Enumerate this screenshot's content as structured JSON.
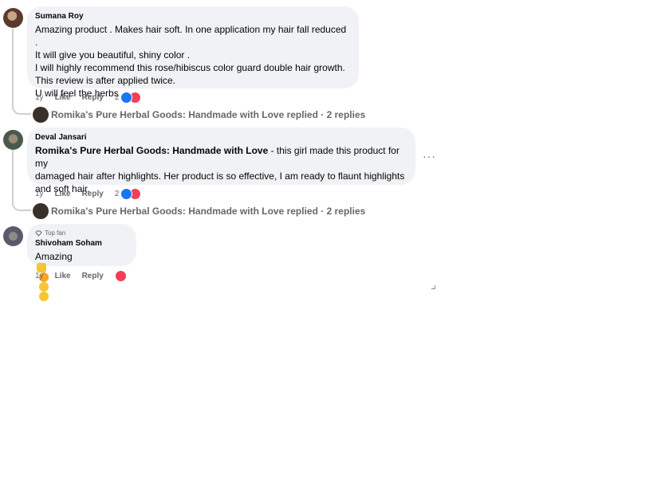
{
  "comments": [
    {
      "author": "Sumana Roy",
      "lines": [
        "Amazing product . Makes hair soft. In one application my hair fall reduced .",
        "It will give you beautiful, shiny color .",
        "I will highly recommend this rose/hibiscus color guard double hair growth.",
        "This review is after applied twice.",
        "U will feel the herbs ."
      ],
      "time": "1y",
      "like": "Like",
      "reply": "Reply",
      "reaction_count": "2",
      "replied": "Romika's Pure Herbal Goods: Handmade with Love replied · 2 replies"
    },
    {
      "author": "Deval Jansari",
      "mention": "Romika's Pure Herbal Goods: Handmade with Love",
      "text_after_mention": " - this girl made this product for my",
      "lines": [
        "damaged hair after highlights. Her product is so effective, I am ready to flaunt highlights",
        "and soft hair."
      ],
      "time": "1y",
      "like": "Like",
      "reply": "Reply",
      "reaction_count": "2",
      "more": "···",
      "replied": "Romika's Pure Herbal Goods: Handmade with Love replied · 2 replies"
    },
    {
      "badge": "Top fan",
      "author": "Shivoham Soham",
      "text": "Amazing",
      "time": "1y",
      "like": "Like",
      "reply": "Reply"
    }
  ],
  "colors": {
    "bubble": "#f0f2f5",
    "like": "#1877f2",
    "love": "#f33e58",
    "meta": "#65676b"
  }
}
